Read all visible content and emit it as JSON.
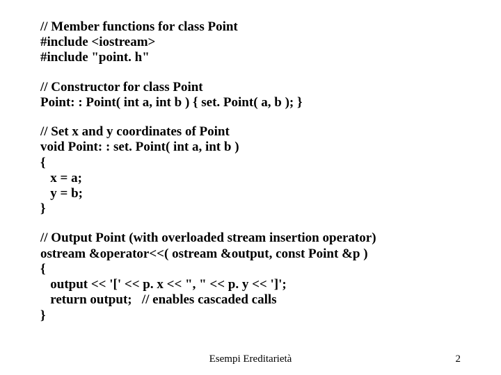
{
  "blocks": {
    "b1": "// Member functions for class Point\n#include <iostream>\n#include \"point. h\"",
    "b2": "// Constructor for class Point\nPoint: : Point( int a, int b ) { set. Point( a, b ); }",
    "b3": "// Set x and y coordinates of Point\nvoid Point: : set. Point( int a, int b )\n{\n   x = a;\n   y = b;\n}",
    "b4": "// Output Point (with overloaded stream insertion operator)\nostream &operator<<( ostream &output, const Point &p )\n{\n   output << '[' << p. x << \", \" << p. y << ']';\n   return output;   // enables cascaded calls\n}"
  },
  "footer": {
    "center": "Esempi Ereditarietà",
    "page": "2"
  }
}
